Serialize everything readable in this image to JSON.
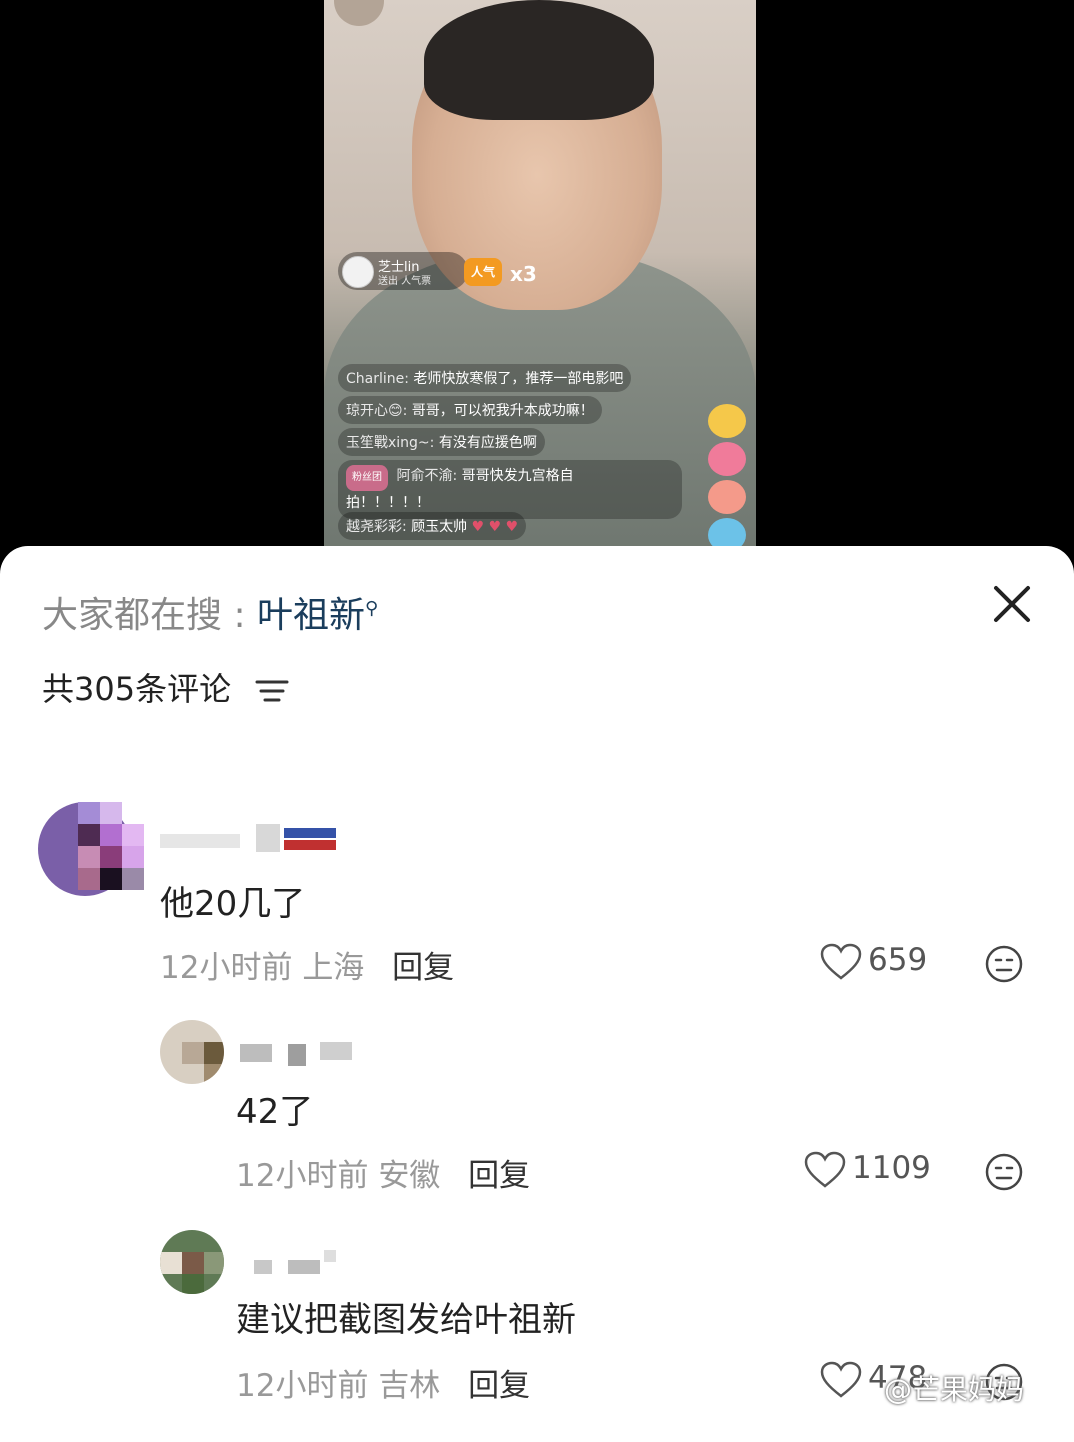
{
  "video": {
    "gift": {
      "sender": "芝士lin",
      "action": "送出 人气票",
      "icon_label": "人气",
      "count": "x3"
    },
    "chat": [
      {
        "user": "Charline:",
        "text": "老师快放寒假了，推荐一部电影吧"
      },
      {
        "user": "琼开心😊:",
        "text": "哥哥，可以祝我升本成功嘛！"
      },
      {
        "user": "玉笙戰xing~:",
        "text": "有没有应援色啊"
      },
      {
        "badge": "粉丝团",
        "user": "阿俞不渝:",
        "text": "哥哥快发九宫格自",
        "text2": "拍！！！！！"
      },
      {
        "user": "越尧彩彩:",
        "text": "顾玉太帅"
      }
    ]
  },
  "sheet": {
    "search_prefix": "大家都在搜 :",
    "search_term": "叶祖新",
    "count_label": "共305条评论"
  },
  "comments": [
    {
      "text": "他20几了",
      "time": "12小时前",
      "location": "上海",
      "reply_label": "回复",
      "likes": "659"
    },
    {
      "text": "42了",
      "time": "12小时前",
      "location": "安徽",
      "reply_label": "回复",
      "likes": "1109"
    },
    {
      "text": "建议把截图发给叶祖新",
      "time": "12小时前",
      "location": "吉林",
      "reply_label": "回复",
      "likes": "478"
    }
  ],
  "watermark": "@芒果妈妈",
  "colors": {
    "accent": "#1a3d5c",
    "gift": "#f39a21"
  }
}
